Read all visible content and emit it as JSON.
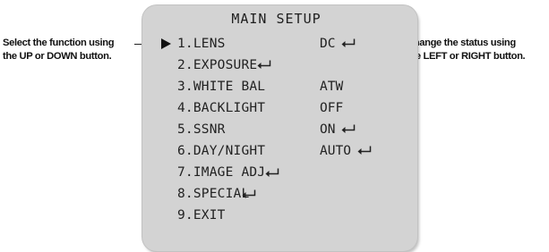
{
  "menu": {
    "title": "MAIN SETUP",
    "items": [
      {
        "label": "1.LENS",
        "value": "DC",
        "submenu": true,
        "selected": true
      },
      {
        "label": "2.EXPOSURE",
        "value": "",
        "submenu": true,
        "selected": false
      },
      {
        "label": "3.WHITE BAL",
        "value": "ATW",
        "submenu": false,
        "selected": false
      },
      {
        "label": "4.BACKLIGHT",
        "value": "OFF",
        "submenu": false,
        "selected": false
      },
      {
        "label": "5.SSNR",
        "value": "ON",
        "submenu": true,
        "selected": false
      },
      {
        "label": "6.DAY/NIGHT",
        "value": "AUTO",
        "submenu": true,
        "selected": false
      },
      {
        "label": "7.IMAGE ADJ",
        "value": "",
        "submenu": true,
        "selected": false
      },
      {
        "label": "8.SPECIAL",
        "value": "",
        "submenu": true,
        "selected": false
      },
      {
        "label": "9.EXIT",
        "value": "",
        "submenu": false,
        "selected": false
      }
    ]
  },
  "annotations": {
    "left": {
      "line1": "Select the function  using",
      "line2": "the UP or DOWN button."
    },
    "right": {
      "line1": "Change the status using",
      "line2": "the LEFT or RIGHT button."
    }
  },
  "icons": {
    "cursor": "triangle-right-icon",
    "submenu": "enter-arrow-icon"
  },
  "colors": {
    "panel": "#d3d3d3",
    "text": "#222222",
    "background": "#ffffff"
  }
}
